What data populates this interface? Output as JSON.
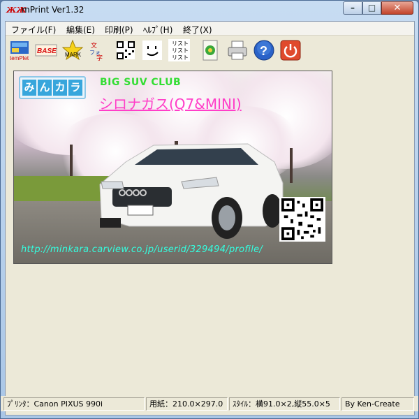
{
  "window": {
    "title": "mPrint Ver1.32",
    "icon_text": "ЖЖ"
  },
  "menu": {
    "items": [
      "ファイル(F)",
      "編集(E)",
      "印刷(P)",
      "ﾍﾙﾌﾟ(H)",
      "終了(X)"
    ]
  },
  "toolbar": {
    "tools": [
      {
        "name": "template-icon",
        "label": "temPlet"
      },
      {
        "name": "base-icon",
        "label": "BASE"
      },
      {
        "name": "mark-icon",
        "label": "MARK"
      },
      {
        "name": "font-icon",
        "label": "フォント"
      },
      {
        "name": "qr-code-icon",
        "label": ""
      },
      {
        "name": "face-icon",
        "label": ""
      },
      {
        "name": "list-icon",
        "label": "リスト"
      },
      {
        "name": "recycle-icon",
        "label": ""
      },
      {
        "name": "printer-icon",
        "label": ""
      },
      {
        "name": "help-icon",
        "label": "?"
      },
      {
        "name": "power-icon",
        "label": ""
      }
    ]
  },
  "card": {
    "logo_text": "みんカラ",
    "club": "BIG SUV CLUB",
    "name": "シロナガス(Q7&MINI)",
    "url": "http://minkara.carview.co.jp/userid/329494/profile/",
    "colors": {
      "club": "#33dd33",
      "name": "#ff3ec8",
      "url": "#33ffe0"
    }
  },
  "status": {
    "printer": "ﾌﾟﾘﾝﾀ：Canon PIXUS 990i",
    "paper": "用紙：210.0×297.0",
    "style": "ｽﾀｲﾙ：横91.0×2,縦55.0×5",
    "author": "By Ken-Create"
  }
}
